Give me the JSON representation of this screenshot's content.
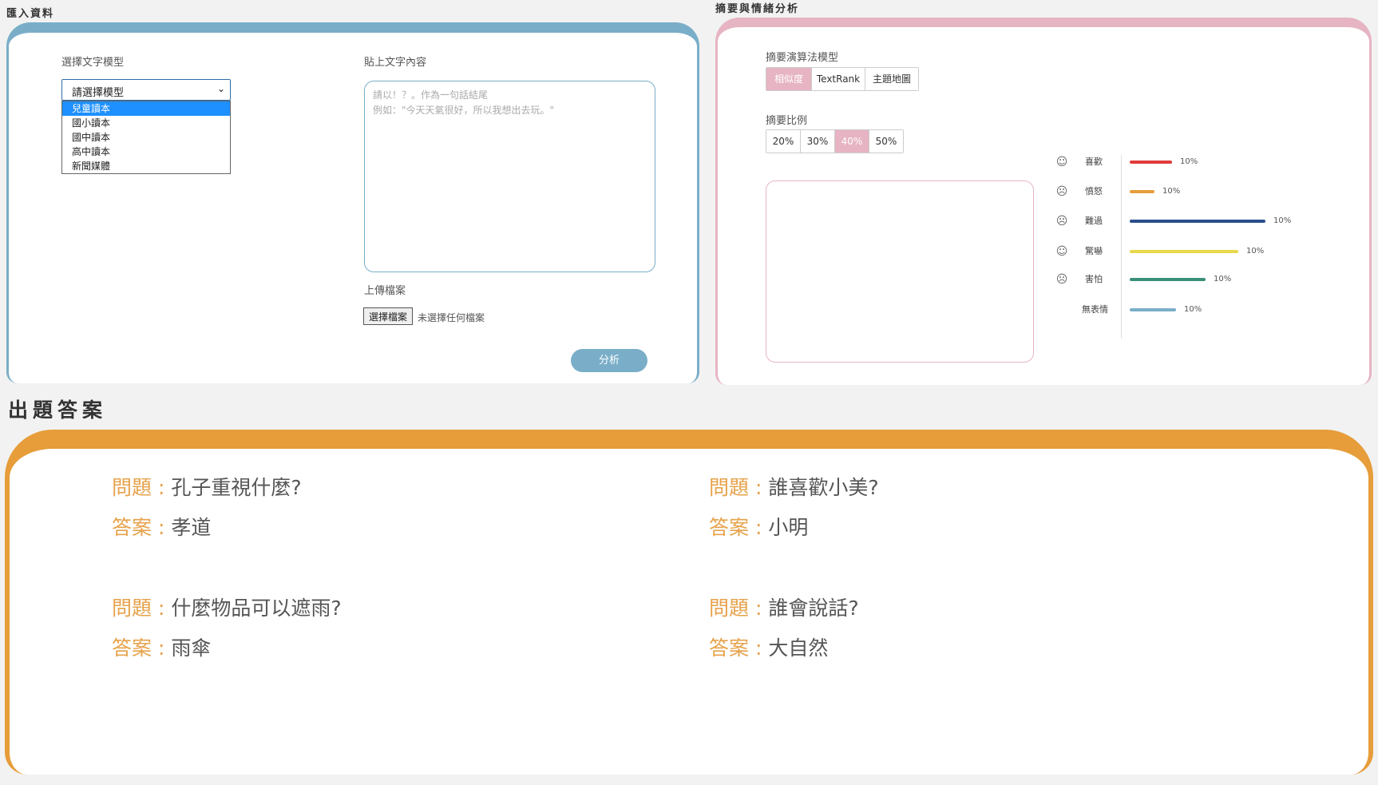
{
  "import_panel": {
    "title": "匯入資料",
    "model_label": "選擇文字模型",
    "select_value": "請選擇模型",
    "options": [
      {
        "label": "兒童讀本",
        "selected": true
      },
      {
        "label": "國小讀本",
        "selected": false
      },
      {
        "label": "國中讀本",
        "selected": false
      },
      {
        "label": "高中讀本",
        "selected": false
      },
      {
        "label": "新聞媒體",
        "selected": false
      }
    ],
    "paste_label": "貼上文字內容",
    "textarea_placeholder_line1": "請以！？。作為一句話結尾",
    "textarea_placeholder_line2": "例如：\"今天天氣很好，所以我想出去玩。\"",
    "upload_label": "上傳檔案",
    "file_button": "選擇檔案",
    "file_status": "未選擇任何檔案",
    "analyze_button": "分析"
  },
  "summary_panel": {
    "title": "摘要與情緒分析",
    "algorithm_label": "摘要演算法模型",
    "algorithms": [
      {
        "label": "相似度",
        "active": true
      },
      {
        "label": "TextRank",
        "active": false
      },
      {
        "label": "主題地圖",
        "active": false
      }
    ],
    "ratio_label": "摘要比例",
    "ratios": [
      {
        "label": "20%",
        "active": false
      },
      {
        "label": "30%",
        "active": false
      },
      {
        "label": "40%",
        "active": true
      },
      {
        "label": "50%",
        "active": false
      }
    ],
    "emotions": [
      {
        "name": "喜歡",
        "icon": "happy-face-icon",
        "value": 0.31,
        "pct": "10%",
        "color": "#e03a3a"
      },
      {
        "name": "憤怒",
        "icon": "angry-face-icon",
        "value": 0.18,
        "pct": "10%",
        "color": "#e69d3a"
      },
      {
        "name": "難過",
        "icon": "sad-face-icon",
        "value": 1.0,
        "pct": "10%",
        "color": "#2a4f8a"
      },
      {
        "name": "驚嚇",
        "icon": "scared-face-icon",
        "value": 0.8,
        "pct": "10%",
        "color": "#e8d84a"
      },
      {
        "name": "害怕",
        "icon": "fear-face-icon",
        "value": 0.56,
        "pct": "10%",
        "color": "#3a8f7a"
      },
      {
        "name": "無表情",
        "icon": "",
        "value": 0.34,
        "pct": "10%",
        "color": "#7aaec8"
      }
    ]
  },
  "qa_panel": {
    "title": "出題答案",
    "question_key": "問題",
    "answer_key": "答案",
    "items": [
      {
        "q": "孔子重視什麼?",
        "a": "孝道"
      },
      {
        "q": "誰喜歡小美?",
        "a": "小明"
      },
      {
        "q": "什麼物品可以遮雨?",
        "a": "雨傘"
      },
      {
        "q": "誰會說話?",
        "a": "大自然"
      }
    ]
  }
}
